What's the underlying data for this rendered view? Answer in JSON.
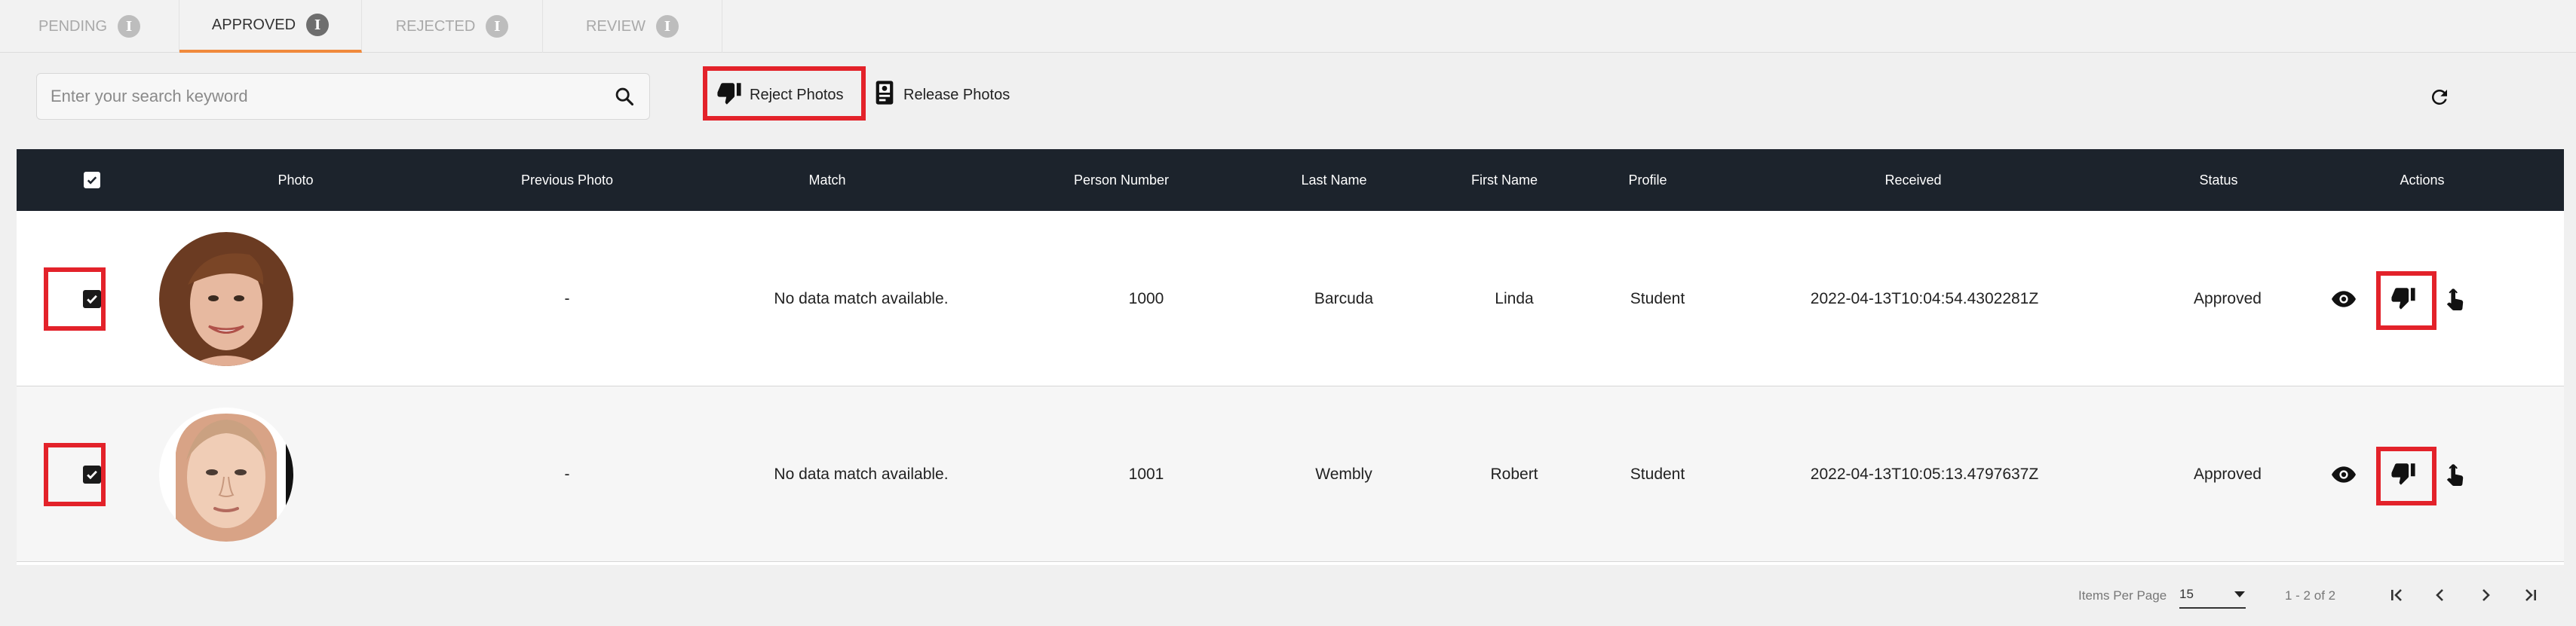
{
  "tabs": [
    {
      "label": "PENDING",
      "active": false
    },
    {
      "label": "APPROVED",
      "active": true
    },
    {
      "label": "REJECTED",
      "active": false
    },
    {
      "label": "REVIEW",
      "active": false
    }
  ],
  "tab_info_glyph": "i",
  "search": {
    "placeholder": "Enter your search keyword",
    "value": "",
    "icon": "search-icon"
  },
  "toolbar": {
    "reject_label": "Reject Photos",
    "reject_icon": "thumbs-down-icon",
    "release_label": "Release Photos",
    "release_icon": "id-badge-icon",
    "refresh_icon": "refresh-icon"
  },
  "table": {
    "headers": {
      "photo": "Photo",
      "previous_photo": "Previous Photo",
      "match": "Match",
      "person_number": "Person Number",
      "last_name": "Last Name",
      "first_name": "First Name",
      "profile": "Profile",
      "received": "Received",
      "status": "Status",
      "actions": "Actions"
    },
    "header_checked": true,
    "rows": [
      {
        "checked": true,
        "previous_photo": "-",
        "match": "No data match available.",
        "person_number": "1000",
        "last_name": "Barcuda",
        "first_name": "Linda",
        "profile": "Student",
        "received": "2022-04-13T10:04:54.4302281Z",
        "status": "Approved"
      },
      {
        "checked": true,
        "previous_photo": "-",
        "match": "No data match available.",
        "person_number": "1001",
        "last_name": "Wembly",
        "first_name": "Robert",
        "profile": "Student",
        "received": "2022-04-13T10:05:13.4797637Z",
        "status": "Approved"
      }
    ]
  },
  "pagination": {
    "items_per_page_label": "Items Per Page",
    "items_per_page_value": "15",
    "range": "1 - 2 of 2"
  },
  "colors": {
    "accent": "#f08a3c",
    "header_bg": "#1c232c",
    "highlight": "#e3222a"
  }
}
